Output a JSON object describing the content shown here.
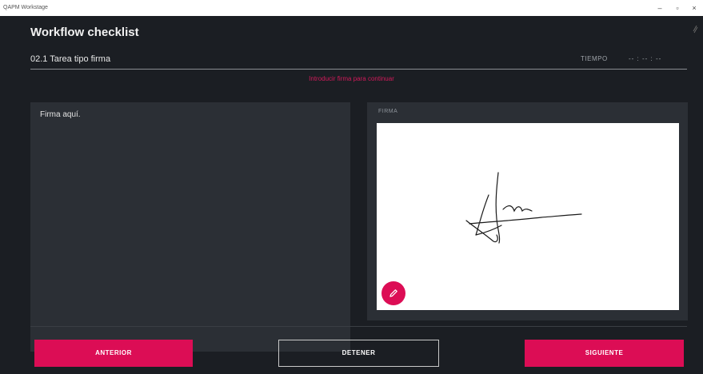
{
  "window": {
    "app_name": "QAPM Workstage",
    "controls": {
      "minimize": "–",
      "maximize": "▫",
      "close": "×"
    }
  },
  "workflow": {
    "title": "Workflow checklist",
    "task_title": "02.1  Tarea tipo firma",
    "time_label": "TIEMPO",
    "time_value": "-- : -- : --",
    "error_message": "Introducir firma para continuar"
  },
  "instructions": {
    "text": "Firma aquí."
  },
  "signature": {
    "label": "FIRMA",
    "edit_icon": "pencil-icon",
    "canvas_bg": "#ffffff"
  },
  "buttons": {
    "previous": "ANTERIOR",
    "stop": "DETENER",
    "next": "SIGUIENTE"
  },
  "colors": {
    "accent": "#dc0d55",
    "background": "#1b1e23",
    "panel": "#2b2f35"
  }
}
